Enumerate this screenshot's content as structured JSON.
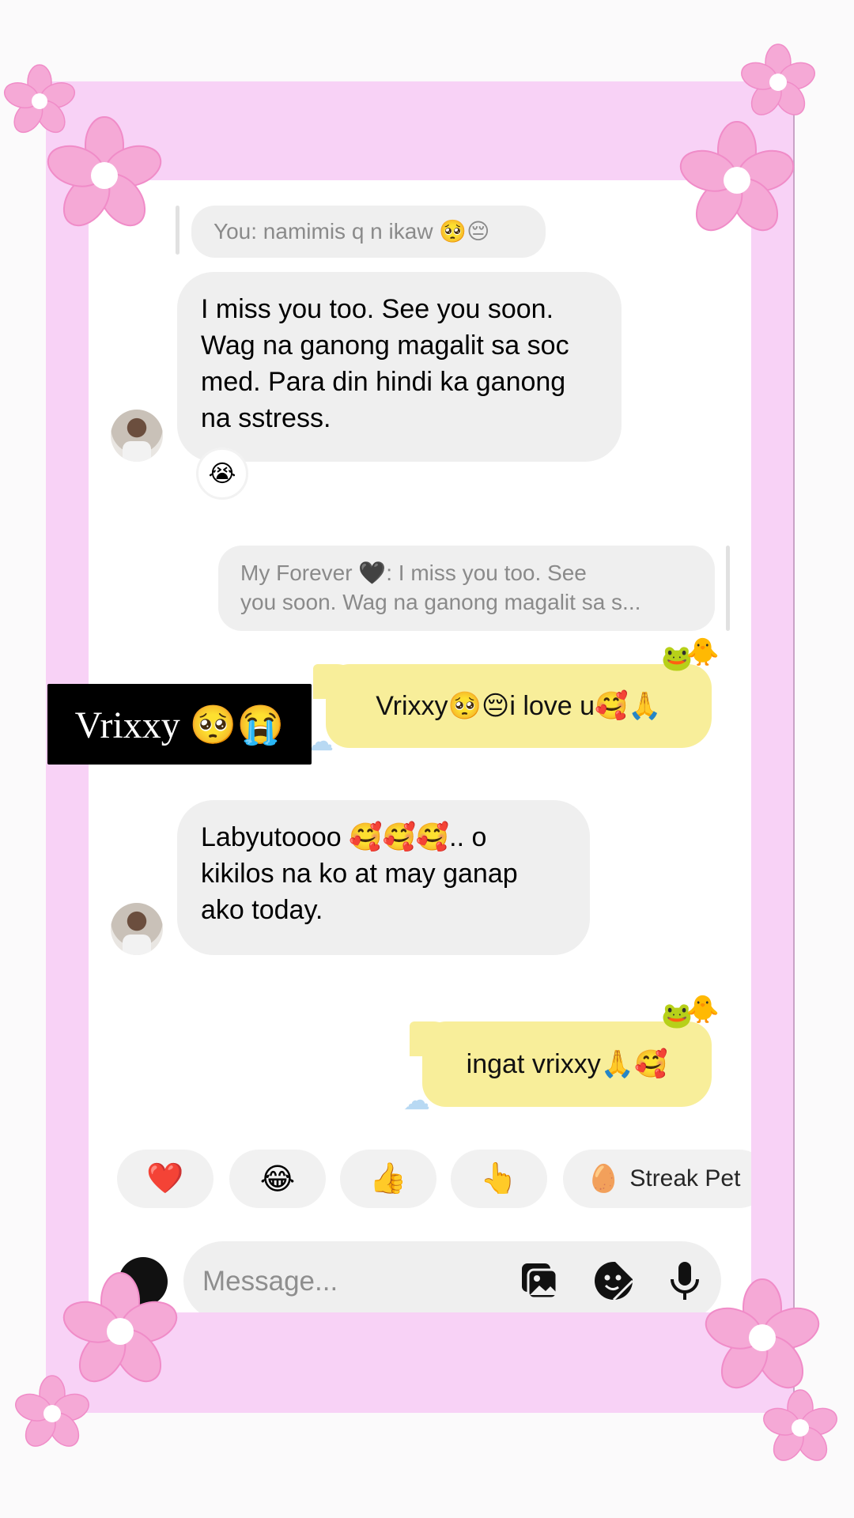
{
  "conversation": {
    "reply_preview_1": "You: namimis q n ikaw 🥺😔",
    "message_1": "I miss you too. See you soon. Wag na ganong magalit sa soc med. Para din hindi ka ganong na sstress.",
    "message_1_reaction": "😭",
    "reply_preview_2_line1": "My Forever 🖤: I miss you too. See",
    "reply_preview_2_line2": "you soon. Wag na ganong magalit sa s...",
    "message_2": "Vrixxy🥺😔i love u🥰🙏",
    "message_3": "Labyutoooo 🥰🥰🥰.. o kikilos na ko at may ganap ako today.",
    "message_4": "ingat vrixxy🙏🥰"
  },
  "overlay": {
    "name_tag": "Vrixxy 🥺😭"
  },
  "quick_reactions": {
    "heart": "❤️",
    "laugh": "😂",
    "thumbs_up": "👍",
    "point": "👆",
    "streak_icon": "🥚",
    "streak_label": "Streak Pet"
  },
  "composer": {
    "placeholder": "Message..."
  },
  "stickers": {
    "duck": "🐥",
    "frog": "🐸",
    "cloud": "☁"
  },
  "colors": {
    "frame": "#f8d2f6",
    "flower": "#f5a9d6",
    "incoming_bubble": "#efefef",
    "outgoing_bubble": "#f8ee9a"
  }
}
